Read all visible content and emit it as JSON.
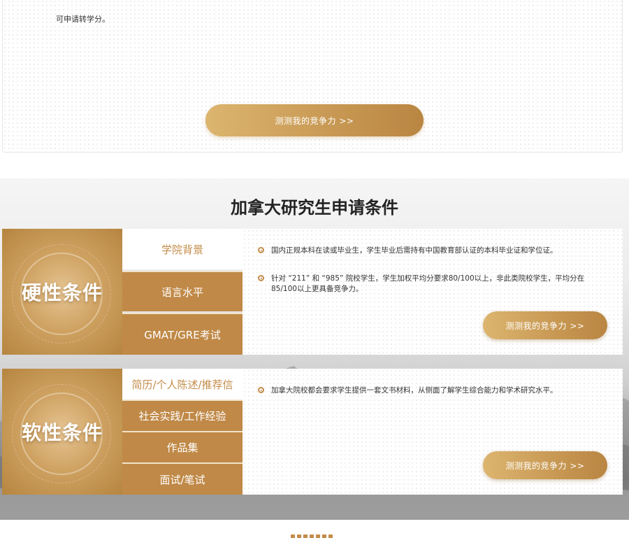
{
  "top": {
    "text": "可申请转学分。",
    "button_label": "测测我的竞争力 >>"
  },
  "conditions": {
    "title": "加拿大研究生申请条件",
    "hard": {
      "label": "硬性条件",
      "tabs": [
        "学院背景",
        "语言水平",
        "GMAT/GRE考试"
      ],
      "bullets": [
        "国内正规本科在读或毕业生，学生毕业后需持有中国教育部认证的本科毕业证和学位证。",
        "针对 “211” 和 “985” 院校学生，学生加权平均分要求80/100以上，非此类院校学生，平均分在85/100以上更具备竞争力。"
      ],
      "button_label": "测测我的竞争力 >>"
    },
    "soft": {
      "label": "软性条件",
      "tabs": [
        "简历/个人陈述/推荐信",
        "社会实践/工作经验",
        "作品集",
        "面试/笔试"
      ],
      "bullets": [
        "加拿大院校都会要求学生提供一套文书材料，从侧面了解学生综合能力和学术研究水平。"
      ],
      "button_label": "测测我的竞争力 >>"
    }
  },
  "colors": {
    "gold": "#c48c49",
    "gold_light": "#dcb56f",
    "title_text": "#222222"
  }
}
